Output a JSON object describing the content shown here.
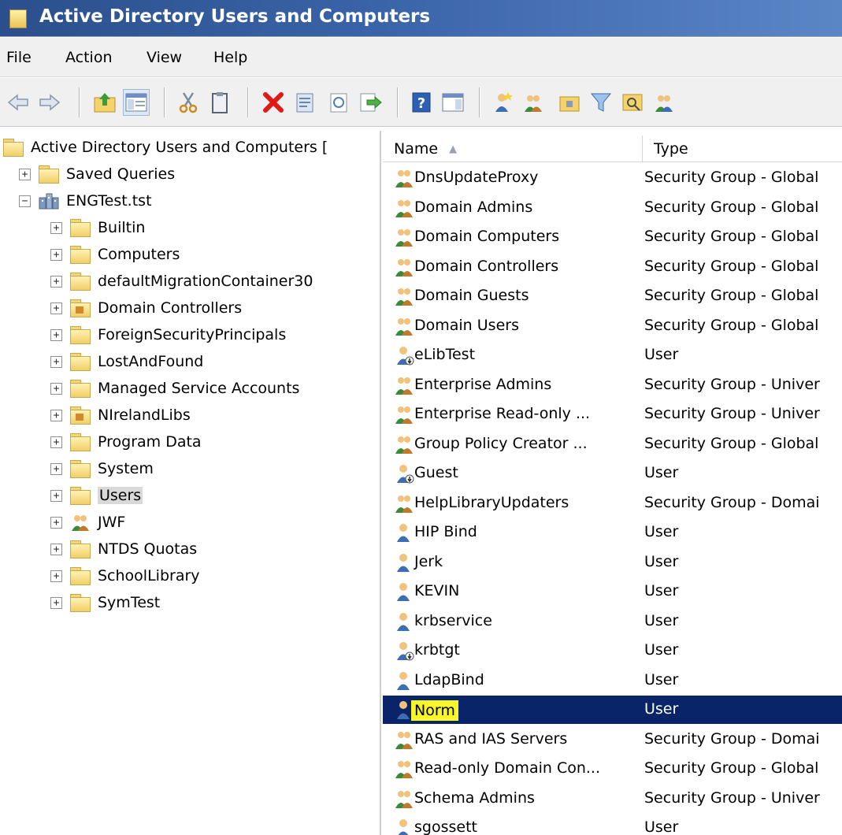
{
  "window": {
    "title": "Active Directory Users and Computers"
  },
  "menu": [
    "File",
    "Action",
    "View",
    "Help"
  ],
  "toolbar": {
    "icons": [
      "back-icon",
      "forward-icon",
      "up-folder-icon",
      "show-console-tree-icon",
      "cut-icon",
      "paste-icon",
      "delete-icon",
      "properties-icon",
      "refresh-icon",
      "export-list-icon",
      "help-icon",
      "show-action-pane-icon",
      "new-user-icon",
      "new-group-icon",
      "new-ou-icon",
      "filter-icon",
      "find-icon",
      "add-to-group-icon"
    ]
  },
  "tree": {
    "root": "Active Directory Users and Computers [",
    "saved_queries": "Saved Queries",
    "domain": "ENGTest.tst",
    "children": [
      "Builtin",
      "Computers",
      "defaultMigrationContainer30",
      "Domain Controllers",
      "ForeignSecurityPrincipals",
      "LostAndFound",
      "Managed Service Accounts",
      "NIrelandLibs",
      "Program Data",
      "System",
      "Users",
      "JWF",
      "NTDS Quotas",
      "SchoolLibrary",
      "SymTest"
    ],
    "selected": "Users"
  },
  "list": {
    "columns": [
      "Name",
      "Type"
    ],
    "rows": [
      {
        "name": "DnsUpdateProxy",
        "type": "Security Group - Global",
        "icon": "group-icon"
      },
      {
        "name": "Domain Admins",
        "type": "Security Group - Global",
        "icon": "group-icon"
      },
      {
        "name": "Domain Computers",
        "type": "Security Group - Global",
        "icon": "group-icon"
      },
      {
        "name": "Domain Controllers",
        "type": "Security Group - Global",
        "icon": "group-icon"
      },
      {
        "name": "Domain Guests",
        "type": "Security Group - Global",
        "icon": "group-icon"
      },
      {
        "name": "Domain Users",
        "type": "Security Group - Global",
        "icon": "group-icon"
      },
      {
        "name": "eLibTest",
        "type": "User",
        "icon": "disabled-user-icon"
      },
      {
        "name": "Enterprise Admins",
        "type": "Security Group - Univer",
        "icon": "group-icon"
      },
      {
        "name": "Enterprise Read-only ...",
        "type": "Security Group - Univer",
        "icon": "group-icon"
      },
      {
        "name": "Group Policy Creator ...",
        "type": "Security Group - Global",
        "icon": "group-icon"
      },
      {
        "name": "Guest",
        "type": "User",
        "icon": "disabled-user-icon"
      },
      {
        "name": "HelpLibraryUpdaters",
        "type": "Security Group - Domai",
        "icon": "group-icon"
      },
      {
        "name": "HIP Bind",
        "type": "User",
        "icon": "user-icon"
      },
      {
        "name": "Jerk",
        "type": "User",
        "icon": "user-icon"
      },
      {
        "name": "KEVIN",
        "type": "User",
        "icon": "user-icon"
      },
      {
        "name": "krbservice",
        "type": "User",
        "icon": "user-icon"
      },
      {
        "name": "krbtgt",
        "type": "User",
        "icon": "disabled-user-icon"
      },
      {
        "name": "LdapBind",
        "type": "User",
        "icon": "user-icon"
      },
      {
        "name": "Norm",
        "type": "User",
        "icon": "user-icon"
      },
      {
        "name": "RAS and IAS Servers",
        "type": "Security Group - Domai",
        "icon": "group-icon"
      },
      {
        "name": "Read-only Domain Con...",
        "type": "Security Group - Global",
        "icon": "group-icon"
      },
      {
        "name": "Schema Admins",
        "type": "Security Group - Univer",
        "icon": "group-icon"
      },
      {
        "name": "sgossett",
        "type": "User",
        "icon": "user-icon"
      }
    ],
    "selected": "Norm"
  },
  "colors": {
    "title_bar": "#2b4f8c",
    "selection": "#0a246a",
    "highlight": "#f6f62a"
  }
}
